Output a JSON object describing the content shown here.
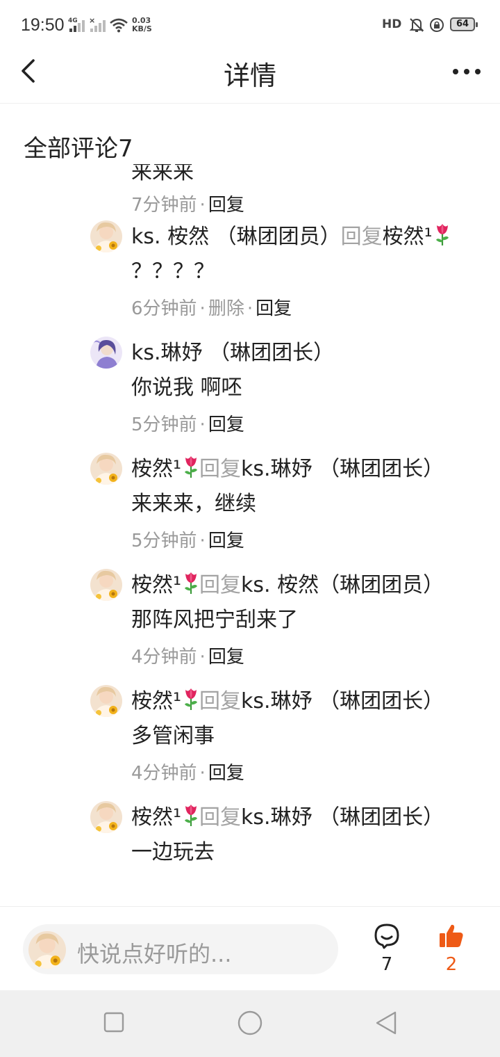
{
  "status_bar": {
    "time": "19:50",
    "sim1_tag": "4G",
    "sim2_tag": "×",
    "net_speed_value": "0.03",
    "net_speed_unit": "KB/S",
    "hd_tag": "HD",
    "battery": "64"
  },
  "header": {
    "title": "详情"
  },
  "comments_section": {
    "title": "全部评论7"
  },
  "colors": {
    "accent": "#ee5a16",
    "reply_gray": "#a3a3a3",
    "text": "#222222",
    "muted": "#999999"
  },
  "replies": [
    {
      "content": "来来来",
      "time": "7分钟前",
      "reply_label": "回复"
    },
    {
      "author": "ks. 桉然 （琳团团员）",
      "reply_word": "回复",
      "target": "桉然¹",
      "content": "？？？？",
      "time": "6分钟前",
      "delete_label": "删除",
      "reply_label": "回复"
    },
    {
      "author": "ks.琳妤 （琳团团长）",
      "content": "你说我 啊呸",
      "time": "5分钟前",
      "reply_label": "回复"
    },
    {
      "author": "桉然¹",
      "reply_word": "回复",
      "target": "ks.琳妤 （琳团团长）",
      "content": "来来来，继续",
      "time": "5分钟前",
      "reply_label": "回复"
    },
    {
      "author": "桉然¹",
      "reply_word": "回复",
      "target": "ks. 桉然（琳团团员）",
      "content": "那阵风把宁刮来了",
      "time": "4分钟前",
      "reply_label": "回复"
    },
    {
      "author": "桉然¹",
      "reply_word": "回复",
      "target": "ks.琳妤 （琳团团长）",
      "content": "多管闲事",
      "time": "4分钟前",
      "reply_label": "回复"
    },
    {
      "author": "桉然¹",
      "reply_word": "回复",
      "target": "ks.琳妤 （琳团团长）",
      "content": "一边玩去",
      "time": "",
      "reply_label": ""
    }
  ],
  "bottom_bar": {
    "input_placeholder": "快说点好听的...",
    "comment_count": "7",
    "like_count": "2",
    "comment_icon": "comment-bubble-icon",
    "like_icon": "thumbs-up-icon"
  },
  "nav_bar": {
    "icons": [
      "recent-apps-icon",
      "home-icon",
      "back-triangle-icon"
    ]
  }
}
